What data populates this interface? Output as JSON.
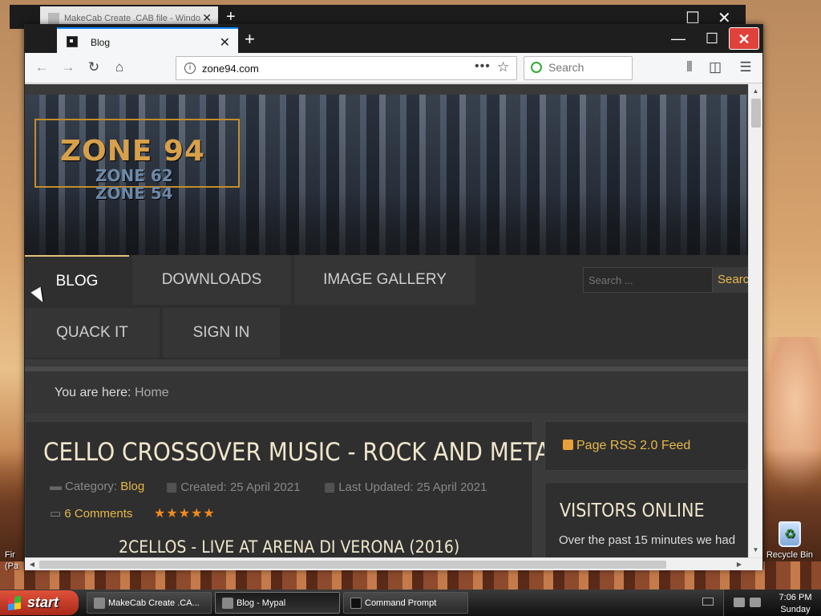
{
  "desktop": {
    "recycle_bin_label": "Recycle Bin",
    "left_labels": [
      "Fir",
      "(Pa"
    ]
  },
  "background_window": {
    "tab_title": "MakeCab Create .CAB file - Windo"
  },
  "browser": {
    "tab_title": "Blog",
    "url": "zone94.com",
    "search_placeholder": "Search",
    "window_controls": {
      "minimize": "—",
      "maximize": "☐",
      "close": "✕"
    }
  },
  "site": {
    "logo_main": "ZONE 94",
    "logo_sub_1": "ZONE 62",
    "logo_sub_2": "ZONE 54",
    "menu": [
      "BLOG",
      "DOWNLOADS",
      "IMAGE GALLERY",
      "QUACK IT",
      "SIGN IN"
    ],
    "search_placeholder": "Search ...",
    "search_button": "Search",
    "breadcrumb_label": "You are here:",
    "breadcrumb_home": "Home",
    "article": {
      "title": "CELLO CROSSOVER MUSIC - ROCK AND METAL",
      "category_label": "Category:",
      "category": "Blog",
      "created": "Created: 25 April 2021",
      "updated": "Last Updated: 25 April 2021",
      "comments": "6 Comments",
      "rating_stars": "★★★★★",
      "subtitle": "2CELLOS - LIVE AT ARENA DI VERONA (2016)"
    },
    "rss_link": "Page RSS 2.0 Feed",
    "visitors_heading": "VISITORS ONLINE",
    "visitors_text": "Over the past 15 minutes we had"
  },
  "taskbar": {
    "start_label": "start",
    "items": [
      "MakeCab Create .CA...",
      "Blog - Mypal",
      "Command Prompt"
    ],
    "clock_time": "7:06 PM",
    "clock_day": "Sunday"
  }
}
